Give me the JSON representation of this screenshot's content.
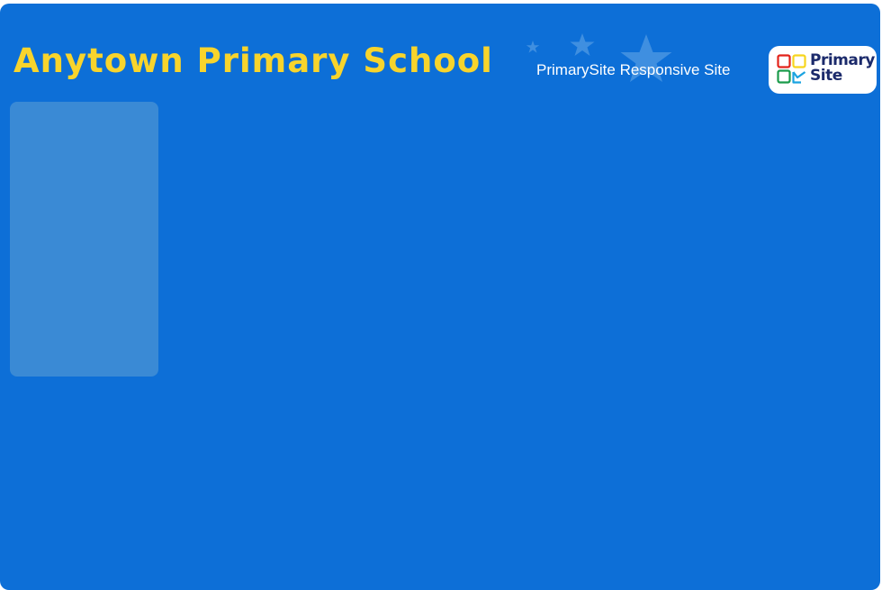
{
  "header": {
    "school_name": "Anytown Primary School",
    "subtitle": "PrimarySite Responsive Site"
  },
  "logo": {
    "line1": "Primary",
    "line2": "Site"
  },
  "colors": {
    "background": "#0d6fd7",
    "title": "#f8d42c",
    "panel": "#3a8ad5"
  }
}
